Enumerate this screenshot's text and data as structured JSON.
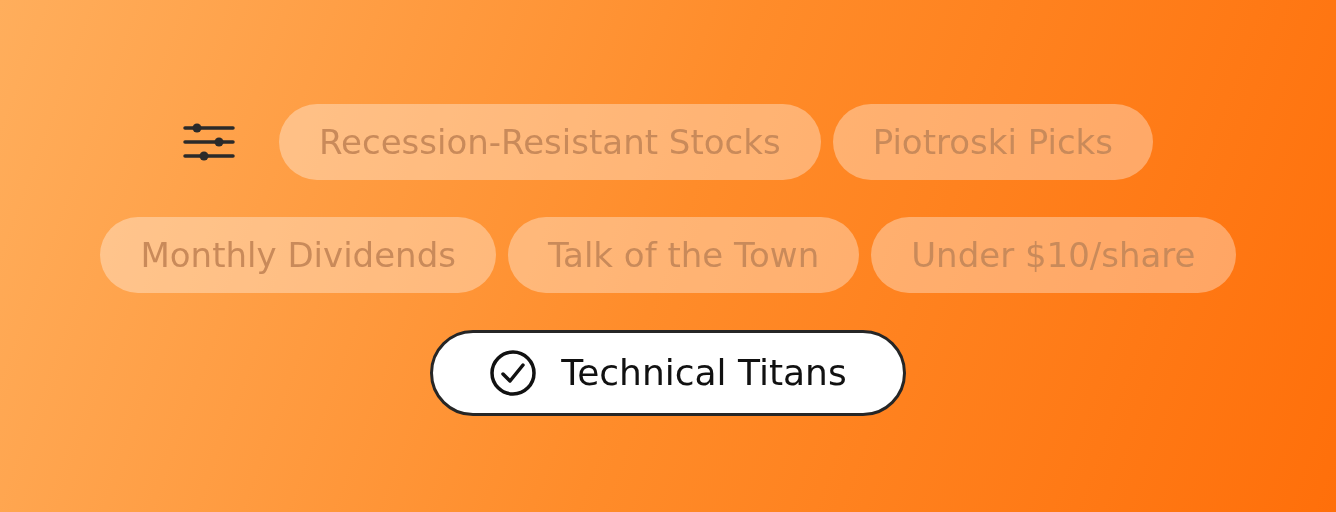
{
  "rows": [
    {
      "chips": [
        {
          "label": "Recession-Resistant Stocks",
          "selected": false
        },
        {
          "label": "Piotroski Picks",
          "selected": false
        }
      ]
    },
    {
      "chips": [
        {
          "label": "Monthly Dividends",
          "selected": false
        },
        {
          "label": "Talk of the Town",
          "selected": false
        },
        {
          "label": "Under $10/share",
          "selected": false
        }
      ]
    },
    {
      "chips": [
        {
          "label": "Technical Titans",
          "selected": true
        }
      ]
    }
  ]
}
